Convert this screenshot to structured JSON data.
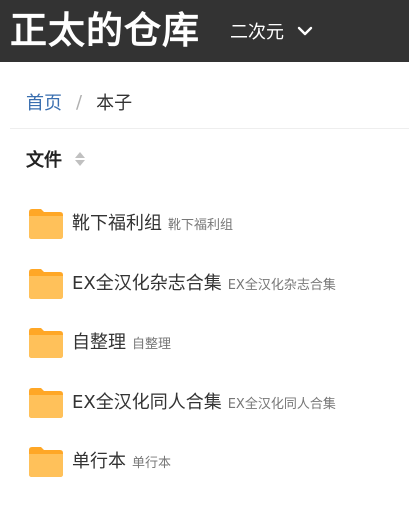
{
  "header": {
    "site_title": "正太的仓库",
    "category": {
      "label": "二次元",
      "icon": "chevron-down-icon"
    },
    "colors": {
      "background": "#333333",
      "text": "#ffffff"
    }
  },
  "breadcrumb": {
    "home": "首页",
    "separator": "/",
    "current": "本子"
  },
  "file_table": {
    "column_header": "文件",
    "sort_icon": "sort-icon",
    "folder_color": "#FFB74D",
    "items": [
      {
        "name": "靴下福利组",
        "desc": "靴下福利组",
        "icon": "folder-icon"
      },
      {
        "name": "EX全汉化杂志合集",
        "desc": "EX全汉化杂志合集",
        "icon": "folder-icon"
      },
      {
        "name": "自整理",
        "desc": "自整理",
        "icon": "folder-icon"
      },
      {
        "name": "EX全汉化同人合集",
        "desc": "EX全汉化同人合集",
        "icon": "folder-icon"
      },
      {
        "name": "单行本",
        "desc": "单行本",
        "icon": "folder-icon"
      }
    ]
  },
  "colors": {
    "link": "#3a6fb0",
    "muted": "#777777"
  }
}
